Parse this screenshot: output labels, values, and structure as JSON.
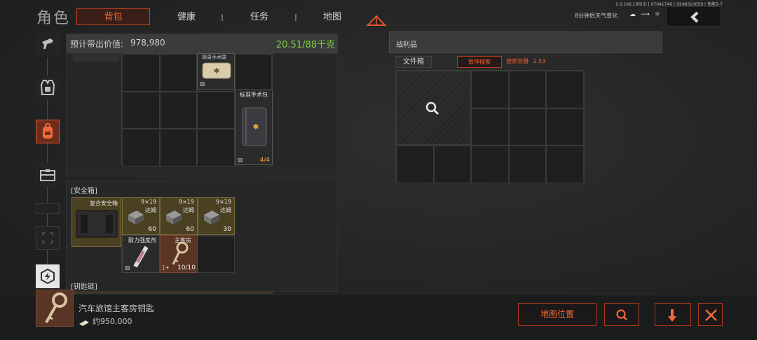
{
  "header": {
    "title": "角色",
    "tabs": [
      {
        "label": "背包",
        "active": true
      },
      {
        "label": "健康",
        "active": false
      },
      {
        "label": "任务",
        "active": false
      },
      {
        "label": "地图",
        "active": false
      }
    ],
    "version": "1.0.166.166(3) | 07041740 | 9348310059 | 性能5-7",
    "weather": "8分钟后天气变化",
    "weather_icons": "☁ ⟶ ☼"
  },
  "nav": {
    "items": [
      "weapon-icon",
      "armor-icon",
      "backpack-icon",
      "container-icon",
      "locked-slot-icon",
      "locked-slot-icon",
      "ability-icon"
    ],
    "active_index": 2
  },
  "backpack": {
    "value_label": "预计带出价值:",
    "value": "978,980",
    "weight": "20.51/88千克",
    "items": [
      {
        "label": "简易手术袋",
        "icon": "medkit-icon"
      },
      {
        "label": "标准手术包",
        "count": "4/4",
        "icon": "surgical-kit-icon"
      }
    ]
  },
  "safe_box": {
    "title": "[安全箱]",
    "container_label": "复合安全箱",
    "items": [
      {
        "caliber": "9×19",
        "label": "达姆",
        "count": "60"
      },
      {
        "caliber": "9×19",
        "label": "达姆",
        "count": "60"
      },
      {
        "caliber": "9×19",
        "label": "达姆",
        "count": "30"
      },
      {
        "label": "耐力强度剂",
        "count": ""
      },
      {
        "label": "主客房",
        "count": "10/10"
      }
    ]
  },
  "key_chain": {
    "title": "[钥匙链]"
  },
  "loot": {
    "title": "战利品",
    "container_name": "文件箱",
    "stop_search": "暂停搜索",
    "search_label": "搜索容器",
    "search_value": "2.53"
  },
  "selected_item": {
    "name": "汽车旅馆主客房钥匙",
    "price": "约950,000",
    "map_button": "地图位置"
  },
  "colors": {
    "accent": "#f05a2e",
    "weight_green": "#7fcc3d"
  }
}
